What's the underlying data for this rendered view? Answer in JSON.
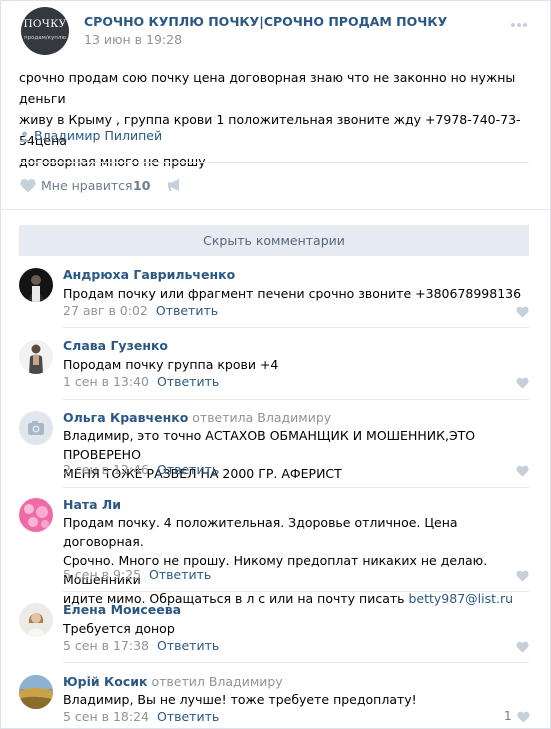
{
  "post": {
    "group_avatar_line1": "ПОЧКУ",
    "group_avatar_line2": "продам/куплю",
    "group_name": "СРОЧНО КУПЛЮ ПОЧКУ|СРОЧНО ПРОДАМ ПОЧКУ",
    "date": "13 июн в 19:28",
    "text_line1": "срочно продам сою почку цена договорная знаю что не законно но нужны деньги",
    "text_line2": "живу в Крыму , группа крови 1 положительная звоните жду +7978-740-73-54цена",
    "text_line3": "договорная много не прошу",
    "author": "Владимир Пилипей",
    "like_label": "Мне нравится",
    "like_count": "10",
    "hide_comments_label": "Скрыть комментарии"
  },
  "comments": [
    {
      "name": "Андрюха Гаврильченко",
      "text": [
        "Продам почку или фрагмент печени срочно звоните +380678998136"
      ],
      "date": "27 авг в 0:02",
      "reply_label": "Ответить"
    },
    {
      "name": "Слава Гузенко",
      "text": [
        "Породам почку группа крови +4"
      ],
      "date": "1 сен в 13:40",
      "reply_label": "Ответить"
    },
    {
      "name": "Ольга Кравченко",
      "replied_to": "ответила Владимиру",
      "text": [
        "Владимир, это точно АСТАХОВ ОБМАНЩИК И МОШЕННИК,ЭТО ПРОВЕРЕНО",
        "МЕНЯ ТОЖЕ РАЗВЕЛ НА 2000 ГР. АФЕРИСТ"
      ],
      "date": "2 сен в 12:46",
      "reply_label": "Ответить"
    },
    {
      "name": "Ната Ли",
      "text": [
        "Продам почку. 4 положительная. Здоровье отличное. Цена договорная.",
        "Срочно. Много не прошу. Никому предоплат никаких не делаю. Мошенники",
        "идите мимо. Обращаться в л с или на почту писать "
      ],
      "email": "betty987@list.ru",
      "date": "5 сен в 9:25",
      "reply_label": "Ответить"
    },
    {
      "name": "Елена Моисеева",
      "text": [
        "Требуется донор"
      ],
      "date": "5 сен в 17:38",
      "reply_label": "Ответить"
    },
    {
      "name": "Юрій Косик",
      "replied_to": "ответил Владимиру",
      "text": [
        "Владимир, Вы не лучше! тоже требуете предоплату!"
      ],
      "date": "5 сен в 18:24",
      "reply_label": "Ответить",
      "like_count": "1"
    }
  ],
  "colors": {
    "link": "#2a5885",
    "meta": "#939393",
    "heart": "#c5d0db",
    "button_bg": "#e5ebf1"
  }
}
